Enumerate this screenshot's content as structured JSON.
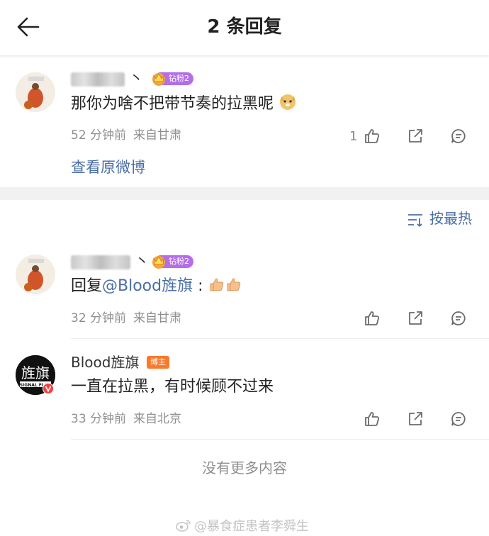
{
  "header": {
    "title": "2 条回复"
  },
  "root": {
    "username_fragment": "丶",
    "fan_badge": "钻粉2",
    "text": "那你为啥不把带节奏的拉黑呢",
    "time": "52 分钟前",
    "location": "来自甘肃",
    "like_count": "1",
    "view_original": "查看原微博"
  },
  "sort": {
    "label": "按最热"
  },
  "replies": [
    {
      "username_fragment": "丶",
      "fan_badge": "钻粉2",
      "text_prefix": "回复",
      "mention": "@Blood旌旗",
      "text_suffix": " :",
      "time": "32 分钟前",
      "location": "来自甘肃"
    },
    {
      "username": "Blood旌旗",
      "host_badge": "博主",
      "avatar_text": "旌旗",
      "avatar_subtext": "SIGNAL FLAG",
      "text": "一直在拉黑，有时候顾不过来",
      "time": "33 分钟前",
      "location": "来自北京"
    }
  ],
  "footer": {
    "no_more": "没有更多内容",
    "watermark": "@暴食症患者李舜生"
  }
}
